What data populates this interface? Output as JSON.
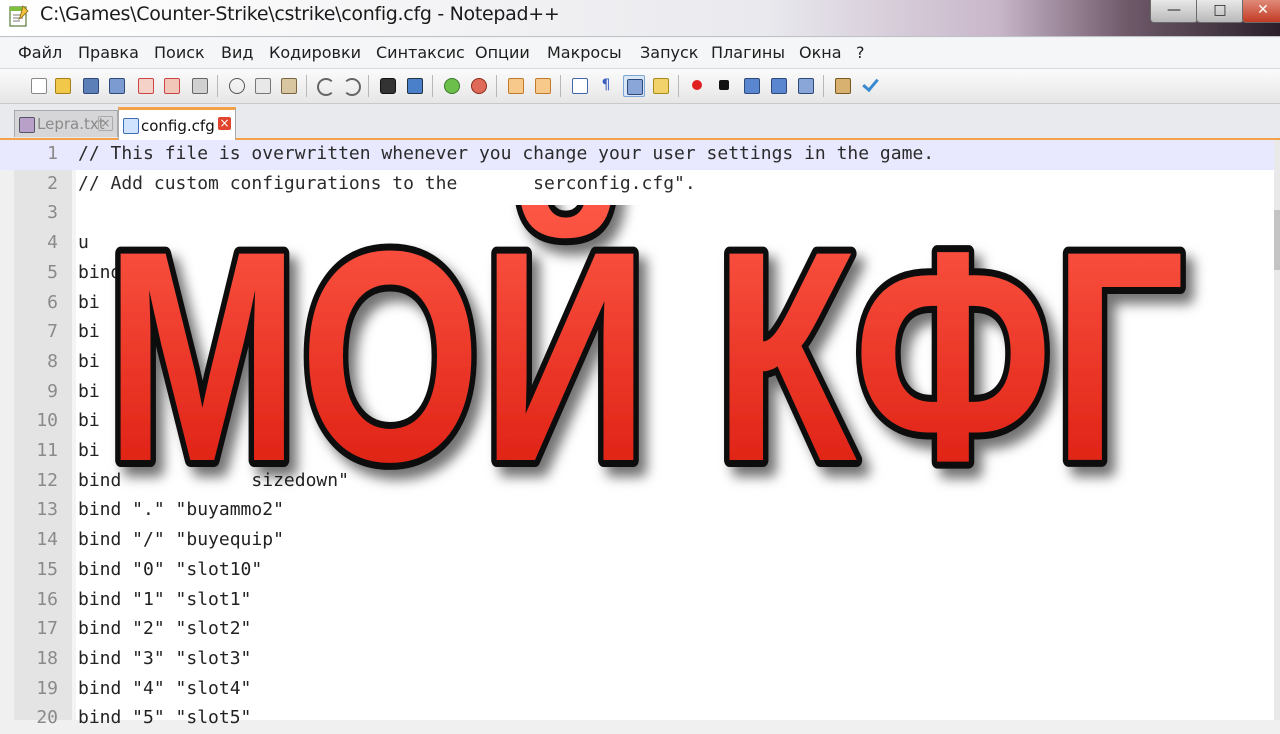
{
  "window": {
    "title": "C:\\Games\\Counter-Strike\\cstrike\\config.cfg - Notepad++",
    "app_icon": "notepad-plus-plus-icon",
    "controls": {
      "minimize": "—",
      "maximize": "□",
      "close": "✕"
    }
  },
  "menu": [
    {
      "label": "Файл"
    },
    {
      "label": "Правка"
    },
    {
      "label": "Поиск"
    },
    {
      "label": "Вид"
    },
    {
      "label": "Кодировки"
    },
    {
      "label": "Синтаксис"
    },
    {
      "label": "Опции"
    },
    {
      "label": "Макросы"
    },
    {
      "label": "Запуск"
    },
    {
      "label": "Плагины"
    },
    {
      "label": "Окна"
    },
    {
      "label": "?"
    }
  ],
  "toolbar": {
    "icons": [
      "new-file-icon",
      "open-file-icon",
      "save-icon",
      "save-all-icon",
      "close-icon",
      "close-all-icon",
      "print-icon",
      "cut-icon",
      "copy-icon",
      "paste-icon",
      "undo-icon",
      "redo-icon",
      "find-icon",
      "replace-icon",
      "zoom-in-icon",
      "zoom-out-icon",
      "sync-vertical-icon",
      "sync-horizontal-icon",
      "word-wrap-icon",
      "show-all-chars-icon",
      "indent-guide-icon",
      "user-language-icon",
      "record-macro-icon",
      "stop-macro-icon",
      "play-macro-icon",
      "run-macro-multiple-icon",
      "save-macro-icon",
      "trim-icon",
      "spell-check-icon"
    ]
  },
  "tabs": [
    {
      "label": "Lepra.txt",
      "active": false
    },
    {
      "label": "config.cfg",
      "active": true
    }
  ],
  "editor": {
    "lines": [
      {
        "n": "1",
        "text": "// This file is overwritten whenever you change your user settings in the game."
      },
      {
        "n": "2",
        "text": "// Add custom configurations to the       serconfig.cfg\"."
      },
      {
        "n": "3",
        "text": ""
      },
      {
        "n": "4",
        "text": "u"
      },
      {
        "n": "5",
        "text": "bind"
      },
      {
        "n": "6",
        "text": "bi"
      },
      {
        "n": "7",
        "text": "bi"
      },
      {
        "n": "8",
        "text": "bi"
      },
      {
        "n": "9",
        "text": "bi"
      },
      {
        "n": "10",
        "text": "bi"
      },
      {
        "n": "11",
        "text": "bi"
      },
      {
        "n": "12",
        "text": "bind            sizedown\""
      },
      {
        "n": "13",
        "text": "bind \".\" \"buyammo2\""
      },
      {
        "n": "14",
        "text": "bind \"/\" \"buyequip\""
      },
      {
        "n": "15",
        "text": "bind \"0\" \"slot10\""
      },
      {
        "n": "16",
        "text": "bind \"1\" \"slot1\""
      },
      {
        "n": "17",
        "text": "bind \"2\" \"slot2\""
      },
      {
        "n": "18",
        "text": "bind \"3\" \"slot3\""
      },
      {
        "n": "19",
        "text": "bind \"4\" \"slot4\""
      },
      {
        "n": "20",
        "text": "bind \"5\" \"slot5\""
      }
    ]
  },
  "overlay": {
    "text": "МОЙ КФГ",
    "fill_top": "#ff5a48",
    "fill_bottom": "#d9180c",
    "outline": "#111111"
  }
}
